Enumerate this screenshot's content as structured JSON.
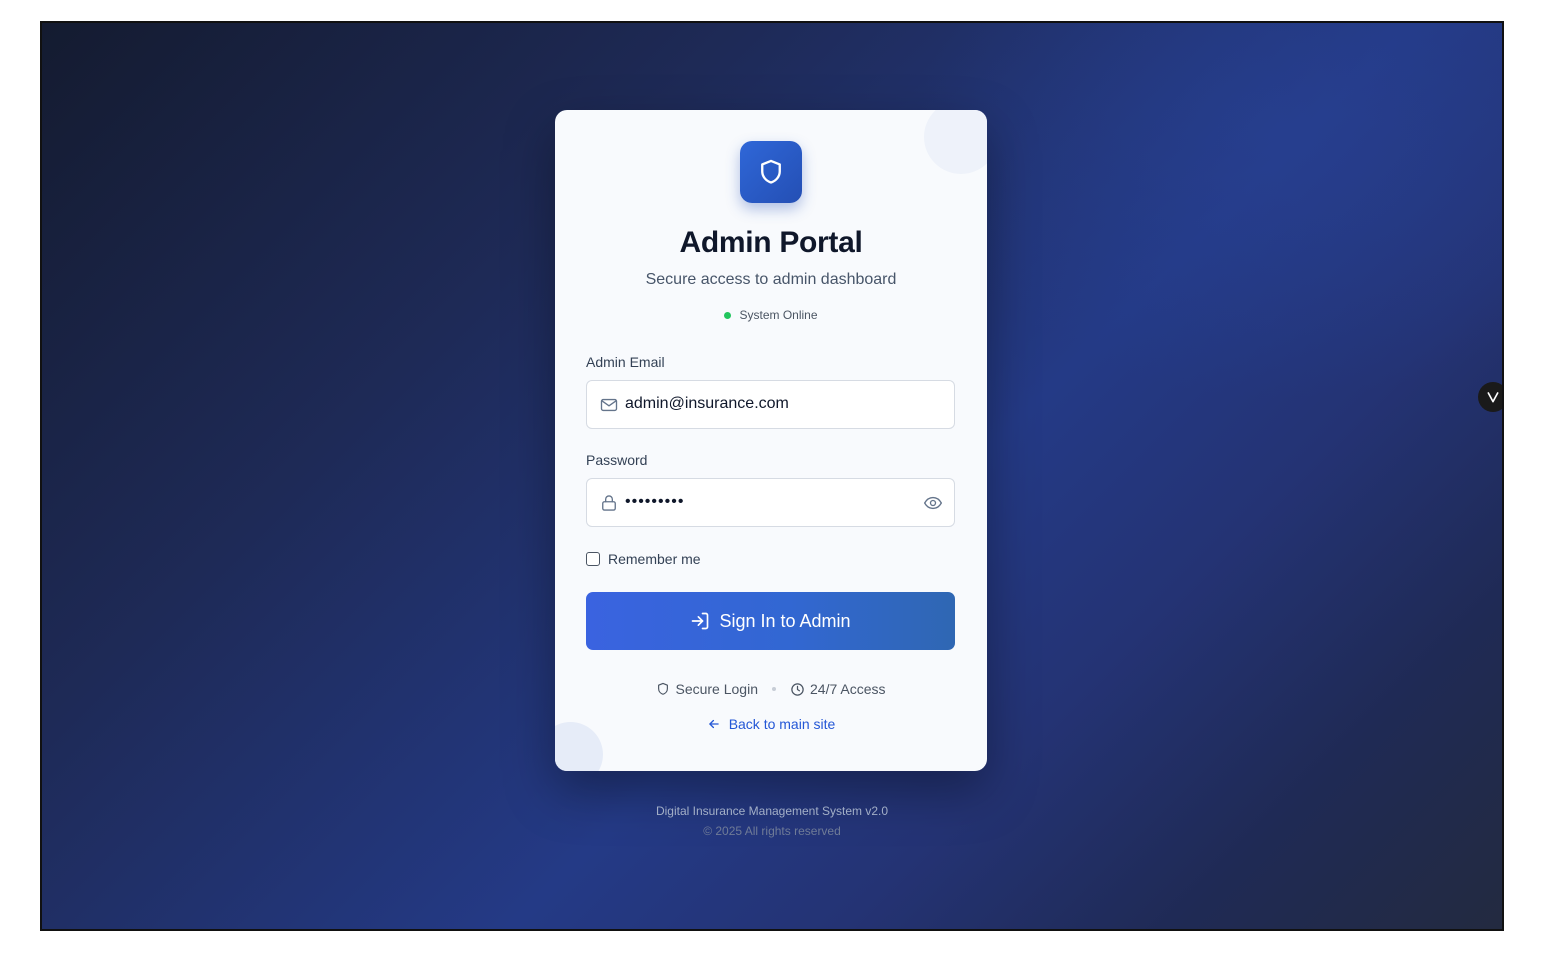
{
  "card": {
    "logo_icon": "shield-icon",
    "title": "Admin Portal",
    "subtitle": "Secure access to admin dashboard",
    "status_text": "System Online",
    "status_color": "#22c55e"
  },
  "form": {
    "email_label": "Admin Email",
    "email_value": "admin@insurance.com",
    "email_icon": "mail-icon",
    "password_label": "Password",
    "password_value": "password1",
    "password_icon": "lock-icon",
    "password_toggle_icon": "eye-icon",
    "remember_label": "Remember me",
    "remember_checked": false,
    "submit_label": "Sign In to Admin",
    "submit_icon": "login-arrow-icon"
  },
  "features": {
    "secure_label": "Secure Login",
    "secure_icon": "shield-icon",
    "access_label": "24/7 Access",
    "access_icon": "clock-icon"
  },
  "back_link": {
    "label": "Back to main site",
    "icon": "arrow-left-icon"
  },
  "footer": {
    "line1": "Digital Insurance Management System v2.0",
    "line2": "© 2025 All rights reserved"
  },
  "side_toggle": {
    "icon": "chevron-down-icon"
  },
  "colors": {
    "accent": "#2f67d8",
    "link": "#2457d6"
  }
}
